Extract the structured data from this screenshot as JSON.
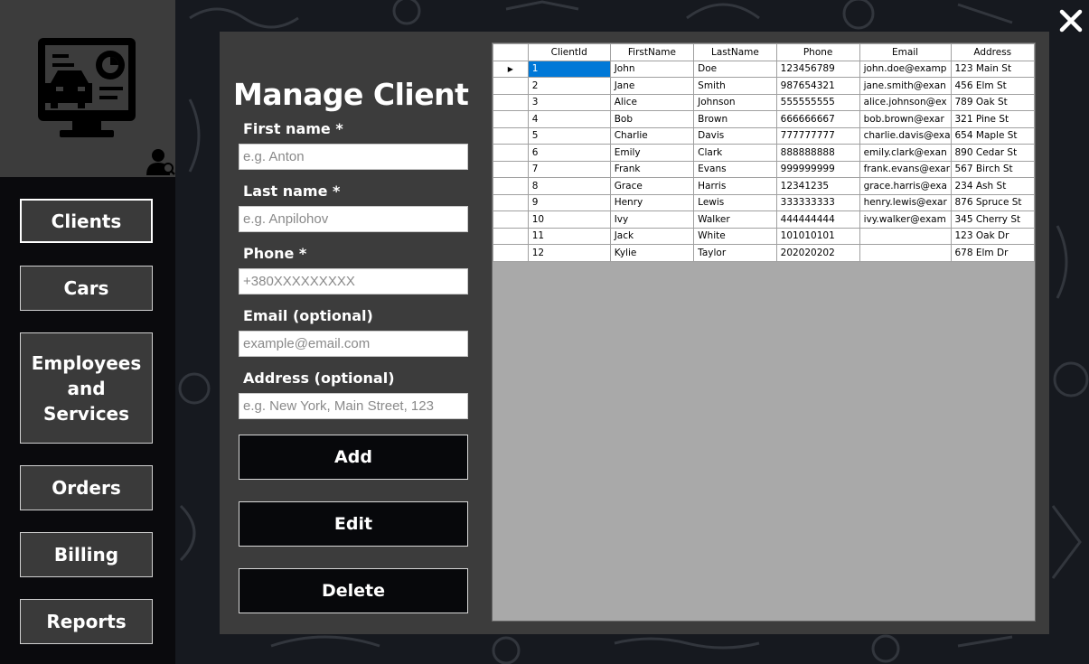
{
  "sidebar": {
    "nav": [
      {
        "label": "Clients",
        "active": true
      },
      {
        "label": "Cars"
      },
      {
        "label": "Employees and Services"
      },
      {
        "label": "Orders"
      },
      {
        "label": "Billing"
      },
      {
        "label": "Reports"
      }
    ]
  },
  "form": {
    "title": "Manage Client",
    "first_name": {
      "label": "First name *",
      "placeholder": "e.g. Anton",
      "value": ""
    },
    "last_name": {
      "label": "Last name *",
      "placeholder": "e.g. Anpilohov",
      "value": ""
    },
    "phone": {
      "label": "Phone *",
      "placeholder": "+380XXXXXXXXX",
      "value": ""
    },
    "email": {
      "label": "Email (optional)",
      "placeholder": "example@email.com",
      "value": ""
    },
    "address": {
      "label": "Address (optional)",
      "placeholder": "e.g. New York, Main Street, 123",
      "value": ""
    },
    "buttons": {
      "add": "Add",
      "edit": "Edit",
      "delete": "Delete"
    }
  },
  "grid": {
    "columns": [
      "ClientId",
      "FirstName",
      "LastName",
      "Phone",
      "Email",
      "Address"
    ],
    "current_row_marker": "▶",
    "rows": [
      [
        "1",
        "John",
        "Doe",
        "123456789",
        "john.doe@examp",
        "123 Main St"
      ],
      [
        "2",
        "Jane",
        "Smith",
        "987654321",
        "jane.smith@exan",
        "456 Elm St"
      ],
      [
        "3",
        "Alice",
        "Johnson",
        "555555555",
        "alice.johnson@ex",
        "789 Oak St"
      ],
      [
        "4",
        "Bob",
        "Brown",
        "666666667",
        "bob.brown@exar",
        "321 Pine St"
      ],
      [
        "5",
        "Charlie",
        "Davis",
        "777777777",
        "charlie.davis@exa",
        "654 Maple St"
      ],
      [
        "6",
        "Emily",
        "Clark",
        "888888888",
        "emily.clark@exan",
        "890 Cedar St"
      ],
      [
        "7",
        "Frank",
        "Evans",
        "999999999",
        "frank.evans@exar",
        "567 Birch St"
      ],
      [
        "8",
        "Grace",
        "Harris",
        "12341235",
        "grace.harris@exa",
        "234 Ash St"
      ],
      [
        "9",
        "Henry",
        "Lewis",
        "333333333",
        "henry.lewis@exar",
        "876 Spruce St"
      ],
      [
        "10",
        "Ivy",
        "Walker",
        "444444444",
        "ivy.walker@exam",
        "345 Cherry St"
      ],
      [
        "11",
        "Jack",
        "White",
        "101010101",
        "",
        "123 Oak Dr"
      ],
      [
        "12",
        "Kylie",
        "Taylor",
        "202020202",
        "",
        "678 Elm Dr"
      ]
    ],
    "selected_row": 1
  },
  "colors": {
    "page_bg": "#16191f",
    "sidebar_bg": "#0a0a0d",
    "panel_bg": "#3c3c3c",
    "button_bg": "#07080b",
    "selection": "#0078d7",
    "grid_empty": "#a9a9a9"
  },
  "icons": {
    "logo": "computer-car-diagnostics-icon",
    "user": "user-icon",
    "close": "close-icon"
  }
}
